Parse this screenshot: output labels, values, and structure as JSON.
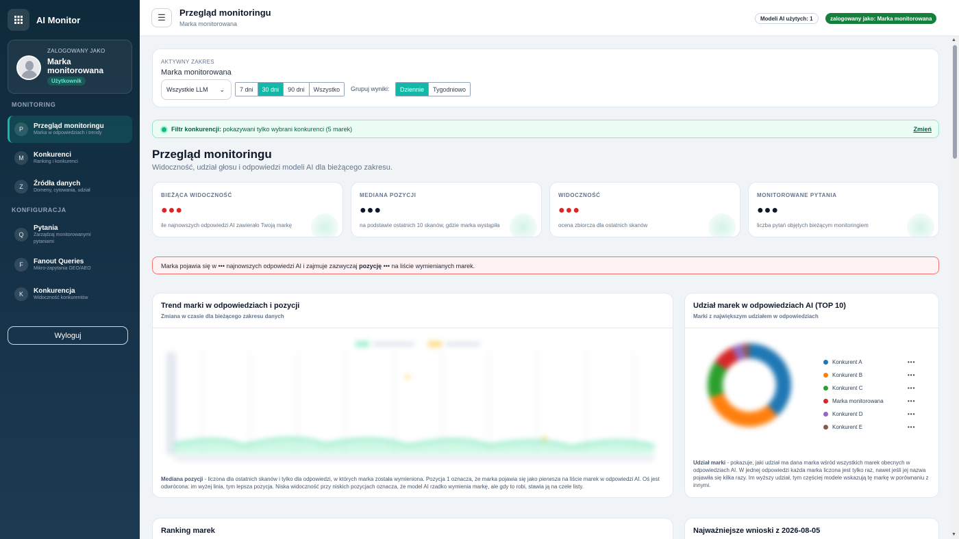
{
  "sidebar": {
    "app_title": "AI Monitor",
    "user": {
      "label": "ZALOGOWANY JAKO",
      "name": "Marka monitorowana",
      "role": "Użytkownik"
    },
    "sections": {
      "monitoring": "MONITORING",
      "config": "KONFIGURACJA"
    },
    "items": [
      {
        "letter": "P",
        "title": "Przegląd monitoringu",
        "sub": "Marka w odpowiedziach i trendy"
      },
      {
        "letter": "M",
        "title": "Konkurenci",
        "sub": "Ranking i konkurenci"
      },
      {
        "letter": "Z",
        "title": "Źródła danych",
        "sub": "Domeny, cytowania, udział"
      },
      {
        "letter": "Q",
        "title": "Pytania",
        "sub": "Zarządzaj monitorowanymi pytaniami"
      },
      {
        "letter": "F",
        "title": "Fanout Queries",
        "sub": "Mikro-zapytania GEO/AEO"
      },
      {
        "letter": "K",
        "title": "Konkurencja",
        "sub": "Widoczność konkurentów"
      }
    ],
    "logout": "Wyloguj"
  },
  "topbar": {
    "menu_icon": "☰",
    "title": "Przegląd monitoringu",
    "subtitle": "Marka monitorowana",
    "models_pill": "Modeli AI użytych: 1",
    "user_pill": "zalogowany jako: Marka monitorowana"
  },
  "range": {
    "label": "AKTYWNY ZAKRES",
    "value": "Marka monitorowana",
    "llm_select": "Wszystkie LLM",
    "periods": [
      "7 dni",
      "30 dni",
      "90 dni",
      "Wszystko"
    ],
    "period_selected": "30 dni",
    "group_label": "Grupuj wyniki:",
    "groups": [
      "Dziennie",
      "Tygodniowo"
    ],
    "group_selected": "Dziennie"
  },
  "filter": {
    "bold": "Filtr konkurencji:",
    "text": " pokazywani tylko wybrani konkurenci (5 marek)",
    "link": "Zmień"
  },
  "overview": {
    "title": "Przegląd monitoringu",
    "subtitle": "Widoczność, udział głosu i odpowiedzi modeli AI dla bieżącego zakresu."
  },
  "kpis": [
    {
      "label": "BIEŻĄCA WIDOCZNOŚĆ",
      "value": "●●●",
      "color": "#dc2626",
      "desc": "ile najnowszych odpowiedzi AI zawierało Twoją markę"
    },
    {
      "label": "MEDIANA POZYCJI",
      "value": "●●●",
      "color": "#0f172a",
      "desc": "na podstawie ostatnich 10 skanów, gdzie marka wystąpiła"
    },
    {
      "label": "WIDOCZNOŚĆ",
      "value": "●●●",
      "color": "#dc2626",
      "desc": "ocena zbiorcza dla ostatnich skanów"
    },
    {
      "label": "MONITOROWANE PYTANIA",
      "value": "●●●",
      "color": "#0f172a",
      "desc": "liczba pytań objętych bieżącym monitoringiem"
    }
  ],
  "alert": {
    "p1": "Marka pojawia się w ",
    "v1": "•••",
    "p2": " najnowszych odpowiedzi AI i zajmuje zazwyczaj ",
    "bold": "pozycję",
    "v2": " •••",
    "p3": " na liście wymienianych marek."
  },
  "trend": {
    "title": "Trend marki w odpowiedziach i pozycji",
    "subtitle": "Zmiana w czasie dla bieżącego zakresu danych",
    "note_bold": "Mediana pozycji",
    "note_1": " - liczona dla ostatnich skanów i tylko dla odpowiedzi, w których marka została wymieniona. Pozycja 1 oznacza, że marka pojawia się jako ",
    "note_italic": "pierwsza",
    "note_2": " na liście marek w odpowiedzi AI. Oś jest odwrócona: im wyżej linia, tym lepsza pozycja. Niska widoczność przy niskich pozycjach oznacza, że model AI rzadko wymienia markę, ale gdy to robi, stawia ją na czele listy."
  },
  "share": {
    "title": "Udział marek w odpowiedziach AI (TOP 10)",
    "subtitle": "Marki z największym udziałem w odpowiedziach",
    "legend": [
      {
        "name": "Konkurent A",
        "value": "•••",
        "color": "#1f77b4"
      },
      {
        "name": "Konkurent B",
        "value": "•••",
        "color": "#ff7f0e"
      },
      {
        "name": "Konkurent C",
        "value": "•••",
        "color": "#2ca02c"
      },
      {
        "name": "Marka monitorowana",
        "value": "•••",
        "color": "#d62728"
      },
      {
        "name": "Konkurent D",
        "value": "•••",
        "color": "#9467bd"
      },
      {
        "name": "Konkurent E",
        "value": "•••",
        "color": "#8c564b"
      }
    ],
    "note_bold": "Udział marki",
    "note": " - pokazuje, jaki udział ma dana marka wśród wszystkich marek obecnych w odpowiedziach AI. W jednej odpowiedzi każda marka liczona jest tylko raz, nawet jeśli jej nazwa pojawiła się kilka razy. Im wyższy udział, tym częściej modele wskazują tę markę w porównaniu z innymi."
  },
  "ranking": {
    "title": "Ranking marek"
  },
  "insights": {
    "title": "Najważniejsze wnioski z 2026-08-05"
  }
}
